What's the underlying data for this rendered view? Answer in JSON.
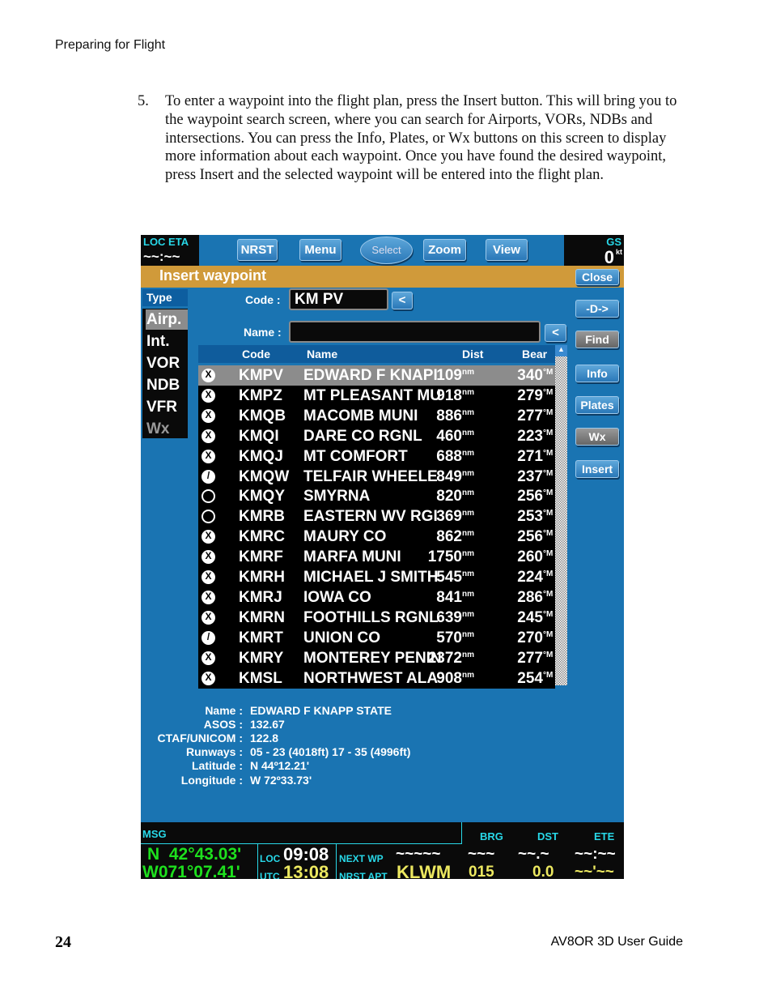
{
  "page": {
    "header": "Preparing for Flight",
    "step_number": "5.",
    "step_text": "To enter a waypoint into the flight plan, press the Insert button. This will bring you to the waypoint search screen, where you can search for Airports, VORs, NDBs and intersections. You can press the Info, Plates, or Wx buttons on this screen to display more information about each waypoint. Once you have found the desired waypoint, press Insert and the selected waypoint will be entered into the flight plan.",
    "page_number": "24",
    "footer": "AV8OR 3D  User Guide"
  },
  "screen": {
    "top": {
      "loc_eta_label": "LOC ETA",
      "loc_eta_value": "~~:~~",
      "buttons": [
        "NRST",
        "Menu",
        "Select",
        "Zoom",
        "View"
      ],
      "gs_label": "GS",
      "gs_value": "0",
      "gs_unit": "kt"
    },
    "title": "Insert waypoint",
    "close": "Close",
    "type_label": "Type",
    "types": [
      "Airp.",
      "Int.",
      "VOR",
      "NDB",
      "VFR",
      "Wx"
    ],
    "selected_type": "Airp.",
    "code_label": "Code :",
    "code_value": "KM PV",
    "name_label": "Name :",
    "name_value": "",
    "back": "<",
    "side_buttons": [
      "-D->",
      "Find",
      "Info",
      "Plates",
      "Wx",
      "Insert"
    ],
    "columns": [
      "Code",
      "Name",
      "Dist",
      "Bear"
    ],
    "rows": [
      {
        "icon": "x",
        "code": "KMPV",
        "name": "EDWARD F KNAPI",
        "dist": "109",
        "bear": "340"
      },
      {
        "icon": "x",
        "code": "KMPZ",
        "name": "MT PLEASANT MU",
        "dist": "918",
        "bear": "279"
      },
      {
        "icon": "x",
        "code": "KMQB",
        "name": "MACOMB MUNI",
        "dist": "886",
        "bear": "277"
      },
      {
        "icon": "x",
        "code": "KMQI",
        "name": "DARE CO RGNL",
        "dist": "460",
        "bear": "223"
      },
      {
        "icon": "x",
        "code": "KMQJ",
        "name": "MT COMFORT",
        "dist": "688",
        "bear": "271"
      },
      {
        "icon": "s",
        "code": "KMQW",
        "name": "TELFAIR WHEELE",
        "dist": "849",
        "bear": "237"
      },
      {
        "icon": "o",
        "code": "KMQY",
        "name": "SMYRNA",
        "dist": "820",
        "bear": "256"
      },
      {
        "icon": "o",
        "code": "KMRB",
        "name": "EASTERN WV RGI",
        "dist": "369",
        "bear": "253"
      },
      {
        "icon": "x",
        "code": "KMRC",
        "name": "MAURY CO",
        "dist": "862",
        "bear": "256"
      },
      {
        "icon": "x",
        "code": "KMRF",
        "name": "MARFA MUNI",
        "dist": "1750",
        "bear": "260"
      },
      {
        "icon": "x",
        "code": "KMRH",
        "name": "MICHAEL J SMITH",
        "dist": "545",
        "bear": "224"
      },
      {
        "icon": "x",
        "code": "KMRJ",
        "name": "IOWA CO",
        "dist": "841",
        "bear": "286"
      },
      {
        "icon": "x",
        "code": "KMRN",
        "name": "FOOTHILLS RGNL",
        "dist": "639",
        "bear": "245"
      },
      {
        "icon": "s",
        "code": "KMRT",
        "name": "UNION CO",
        "dist": "570",
        "bear": "270"
      },
      {
        "icon": "x",
        "code": "KMRY",
        "name": "MONTEREY PENIN",
        "dist": "2372",
        "bear": "277"
      },
      {
        "icon": "x",
        "code": "KMSL",
        "name": "NORTHWEST ALA",
        "dist": "908",
        "bear": "254"
      }
    ],
    "dist_unit": "nm",
    "bear_unit": "°M",
    "info": [
      {
        "label": "Name :",
        "value": "EDWARD F KNAPP STATE"
      },
      {
        "label": "ASOS :",
        "value": "132.67"
      },
      {
        "label": "CTAF/UNICOM :",
        "value": "122.8"
      },
      {
        "label": "Runways :",
        "value": "05 - 23 (4018ft)  17 - 35 (4996ft)"
      },
      {
        "label": "Latitude :",
        "value": "N 44º12.21'"
      },
      {
        "label": "Longitude :",
        "value": "W 72º33.73'"
      }
    ],
    "bottom": {
      "msg": "MSG",
      "brg": "BRG",
      "dst": "DST",
      "ete": "ETE",
      "lat": "N  42°43.03'",
      "lon": "W071°07.41'",
      "loc_label": "LOC",
      "loc_time": "09:08",
      "utc_label": "UTC",
      "utc_time": "13:08",
      "next_wp_label": "NEXT WP",
      "next_wp": "~~~~~",
      "next_brg": "~~~",
      "next_dst": "~~.~",
      "next_ete": "~~:~~",
      "nrst_apt_label": "NRST APT",
      "nrst_apt": "KLWM",
      "nrst_brg": "015",
      "nrst_dst": "0.0",
      "nrst_ete": "~~'~~"
    }
  }
}
